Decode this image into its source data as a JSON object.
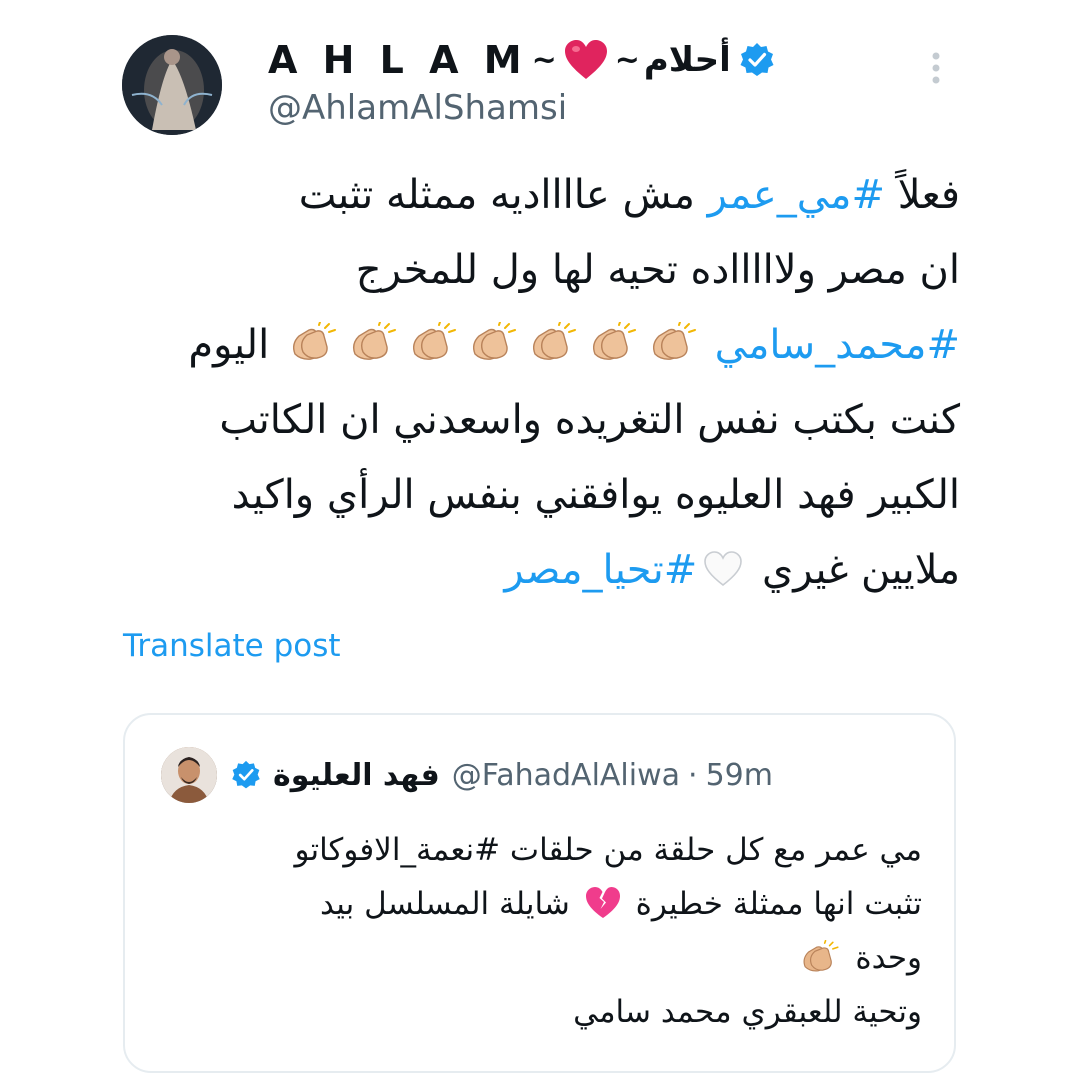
{
  "colors": {
    "link_blue": "#1d9bf0",
    "secondary_text": "#536471",
    "primary_text": "#0f1419",
    "heart_red": "#e0245e",
    "broken_heart_pink": "#f03c8c"
  },
  "author": {
    "display_name_latin": "A H L A M",
    "tilde_left": "~",
    "tilde_right": "~",
    "display_name_arabic": "أحلام",
    "handle": "@AhlamAlShamsi",
    "avatar_icon": "avatar-photo",
    "heart_icon": "red-heart-emoji",
    "verified_icon": "verified-badge-icon",
    "more_icon": "more-options-icon"
  },
  "tweet": {
    "line1_start": "فعلاً ",
    "line1_hashtag": "#مي_عمر",
    "line1_end": " مش عااااديه ممثله تثبت",
    "line2": "ان مصر ولاااااده تحيه لها ول للمخرج",
    "line3_hashtag": "#محمد_سامي",
    "line3_claps_count": 7,
    "line3_end": " اليوم",
    "line4": "كنت بكتب نفس التغريده واسعدني ان الكاتب",
    "line5": "الكبير فهد العليوه يوافقني بنفس الرأي واكيد",
    "line6_start": "ملايين غيري ",
    "line6_hashtag": "#تحيا_مصر",
    "white_heart_icon": "white-heart-emoji",
    "clap_icon": "clapping-hands-emoji"
  },
  "translate_label": "Translate post",
  "quote": {
    "author_name": "فهد العليوة",
    "handle": "@FahadAlAliwa",
    "separator": "·",
    "time": "59m",
    "line1": "مي عمر مع كل حلقة من حلقات #نعمة_الافوكاتو",
    "line2_start": "تثبت انها ممثلة خطيرة ",
    "line2_end": " شايلة المسلسل بيد",
    "line3": "وحدة ",
    "line4": "وتحية للعبقري محمد سامي",
    "broken_heart_icon": "broken-heart-emoji",
    "clap_icon": "clapping-hands-emoji"
  }
}
